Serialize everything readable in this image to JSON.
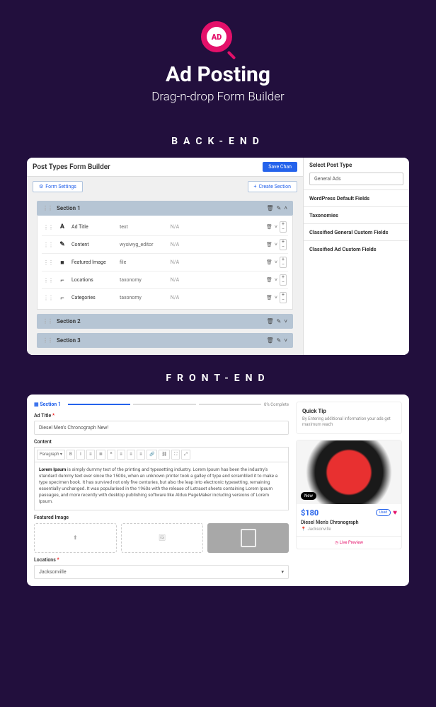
{
  "hero": {
    "logo_text": "AD",
    "title": "Ad Posting",
    "subtitle": "Drag-n-drop Form Builder"
  },
  "labels": {
    "backend": "BACK-END",
    "frontend": "FRONT-END"
  },
  "backend": {
    "title": "Post Types Form Builder",
    "save": "Save Chan",
    "form_settings": "Form Settings",
    "create_section": "Create Section",
    "sections": [
      "Section 1",
      "Section 2",
      "Section 3"
    ],
    "fields": [
      {
        "icon": "A",
        "name": "Ad Title",
        "type": "text",
        "na": "N/A"
      },
      {
        "icon": "✎",
        "name": "Content",
        "type": "wysiwyg_editor",
        "na": "N/A"
      },
      {
        "icon": "■",
        "name": "Featured Image",
        "type": "file",
        "na": "N/A"
      },
      {
        "icon": "⌐",
        "name": "Locations",
        "type": "taxonomy",
        "na": "N/A"
      },
      {
        "icon": "⌐",
        "name": "Categories",
        "type": "taxonomy",
        "na": "N/A"
      }
    ],
    "sidebar": {
      "select_label": "Select Post Type",
      "select_value": "General Ads",
      "items": [
        "WordPress Default Fields",
        "Taxonomies",
        "Classified General Custom Fields",
        "Classified Ad Custom Fields"
      ]
    }
  },
  "frontend": {
    "step": "Section 1",
    "pct": "0% Complete",
    "ad_title_label": "Ad Title",
    "ad_title_value": "Diesel Men's Chronograph New!",
    "content_label": "Content",
    "editor_para": "Lorem Ipsum",
    "editor_text": " is simply dummy text of the printing and typesetting industry. Lorem Ipsum has been the industry's standard dummy text ever since the 1500s, when an unknown printer took a galley of type and scrambled it to make a type specimen book. It has survived not only five centuries, but also the leap into electronic typesetting, remaining essentially unchanged. It was popularised in the 1960s with the release of Letraset sheets containing Lorem Ipsum passages, and more recently with desktop publishing software like Aldus PageMaker including versions of Lorem Ipsum.",
    "featured_label": "Featured Image",
    "locations_label": "Locations",
    "locations_value": "Jacksonville",
    "tip": {
      "title": "Quick Tip",
      "text": "By Entering additional information your ads get maximum reach"
    },
    "preview": {
      "badge": "New",
      "price": "$180",
      "used": "Used",
      "title": "Diesel Men's Chronograph",
      "location": "Jacksonville",
      "live": "Live Preview"
    }
  }
}
